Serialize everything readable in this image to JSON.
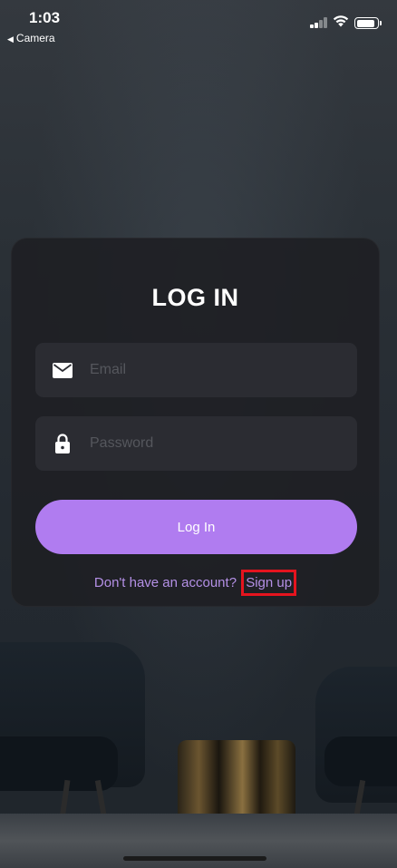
{
  "status_bar": {
    "time": "1:03",
    "back_app": "Camera"
  },
  "login": {
    "title": "LOG IN",
    "email_placeholder": "Email",
    "password_placeholder": "Password",
    "login_button": "Log In",
    "signup_prompt": "Don't have an account?",
    "signup_link": "Sign up"
  },
  "colors": {
    "accent": "#b07cf0",
    "link": "#b490e6",
    "highlight_box": "#e5141e",
    "card_bg": "#1e1f24",
    "field_bg": "#2b2c32"
  },
  "icons": {
    "email": "mail-icon",
    "password": "lock-icon"
  }
}
